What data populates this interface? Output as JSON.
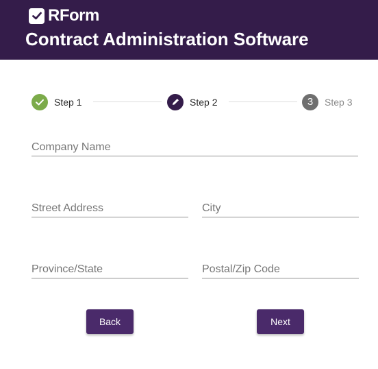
{
  "header": {
    "logo_text": "RForm",
    "title": "Contract Administration Software",
    "background_color": "#341c4a"
  },
  "stepper": {
    "steps": [
      {
        "label": "Step 1",
        "status": "completed",
        "icon": "check-icon",
        "color": "#7cab4a"
      },
      {
        "label": "Step 2",
        "status": "active",
        "icon": "pencil-icon",
        "color": "#341c4a"
      },
      {
        "label": "Step 3",
        "status": "pending",
        "number": "3",
        "color": "#6f6f6f"
      }
    ]
  },
  "form": {
    "company_name": {
      "placeholder": "Company Name",
      "value": ""
    },
    "street_address": {
      "placeholder": "Street Address",
      "value": ""
    },
    "city": {
      "placeholder": "City",
      "value": ""
    },
    "province_state": {
      "placeholder": "Province/State",
      "value": ""
    },
    "postal_zip": {
      "placeholder": "Postal/Zip Code",
      "value": ""
    }
  },
  "buttons": {
    "back_label": "Back",
    "next_label": "Next",
    "color": "#4a2a6a"
  }
}
